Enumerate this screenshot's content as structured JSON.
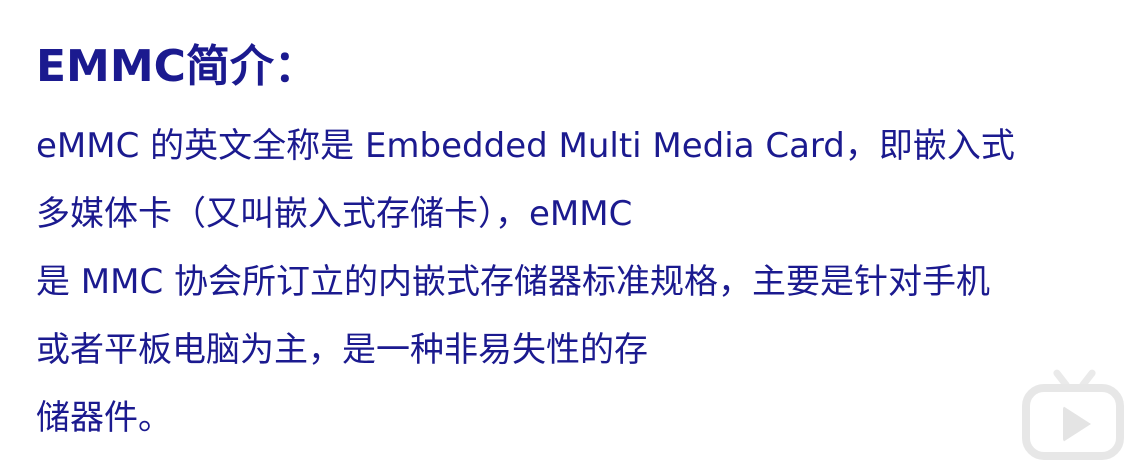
{
  "slide": {
    "title": "EMMC简介：",
    "body_lines": [
      "eMMC 的英文全称是 Embedded Multi Media Card，即嵌入式",
      "多媒体卡（又叫嵌入式存储卡），eMMC",
      "是 MMC 协会所订立的内嵌式存储器标准规格，主要是针对手机",
      "或者平板电脑为主，是一种非易失性的存",
      "储器件。"
    ],
    "text_color": "#1b1a8f"
  },
  "watermark": {
    "icon": "tv-play-icon"
  }
}
